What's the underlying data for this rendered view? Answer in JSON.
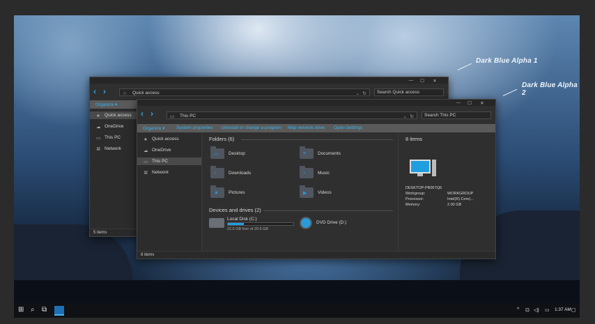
{
  "watermarks": [
    "Dark Blue Alpha 1",
    "Dark Blue Alpha 2"
  ],
  "back_window": {
    "address": "Quick access",
    "search_placeholder": "Search Quick access",
    "ribbon": [
      "Organize ▾"
    ],
    "nav": [
      {
        "label": "Quick access",
        "icon": "star-icon",
        "selected": true
      },
      {
        "label": "OneDrive",
        "icon": "cloud-icon",
        "selected": false
      },
      {
        "label": "This PC",
        "icon": "computer-icon",
        "selected": false
      },
      {
        "label": "Network",
        "icon": "network-icon",
        "selected": false
      }
    ],
    "status": "5 items",
    "controls": [
      "—",
      "☐",
      "✕"
    ]
  },
  "front_window": {
    "address": "This PC",
    "search_placeholder": "Search This PC",
    "ribbon": [
      "Organize ▾",
      "System properties",
      "Uninstall or change a program",
      "Map network drive",
      "Open Settings"
    ],
    "nav": [
      {
        "label": "Quick access",
        "icon": "star-icon",
        "selected": false
      },
      {
        "label": "OneDrive",
        "icon": "cloud-icon",
        "selected": false
      },
      {
        "label": "This PC",
        "icon": "computer-icon",
        "selected": true
      },
      {
        "label": "Network",
        "icon": "network-icon",
        "selected": false
      }
    ],
    "folders_header": "Folders (6)",
    "folders": [
      {
        "label": "Desktop",
        "glyph": "▭"
      },
      {
        "label": "Documents",
        "glyph": "≡"
      },
      {
        "label": "Downloads",
        "glyph": "↓"
      },
      {
        "label": "Music",
        "glyph": "♪"
      },
      {
        "label": "Pictures",
        "glyph": "▲"
      },
      {
        "label": "Videos",
        "glyph": "▶"
      }
    ],
    "drives_header": "Devices and drives (2)",
    "drives": [
      {
        "label": "Local Disk (C:)",
        "detail": "22.5 GB free of 29.5 GB",
        "used_fraction": 0.24
      },
      {
        "label": "DVD Drive (D:)",
        "detail": ""
      }
    ],
    "details": {
      "count": "8 items",
      "rows": [
        {
          "key": "DESKTOP-PB06TQ6",
          "value": ""
        },
        {
          "key": "Workgroup:",
          "value": "WORKGROUP"
        },
        {
          "key": "Processor:",
          "value": "Intel(R) Core(..."
        },
        {
          "key": "Memory:",
          "value": "2.00 GB"
        }
      ]
    },
    "status": "8 items",
    "controls": [
      "—",
      "☐",
      "✕"
    ]
  },
  "taskbar": {
    "clock": "1:37 AM",
    "tray_icons": [
      "^",
      "⊡",
      "◁)",
      "▭"
    ]
  },
  "colors": {
    "accent": "#25a8e8",
    "window_bg": "#2f2f2f",
    "ribbon_bg": "#5a5a5a"
  }
}
